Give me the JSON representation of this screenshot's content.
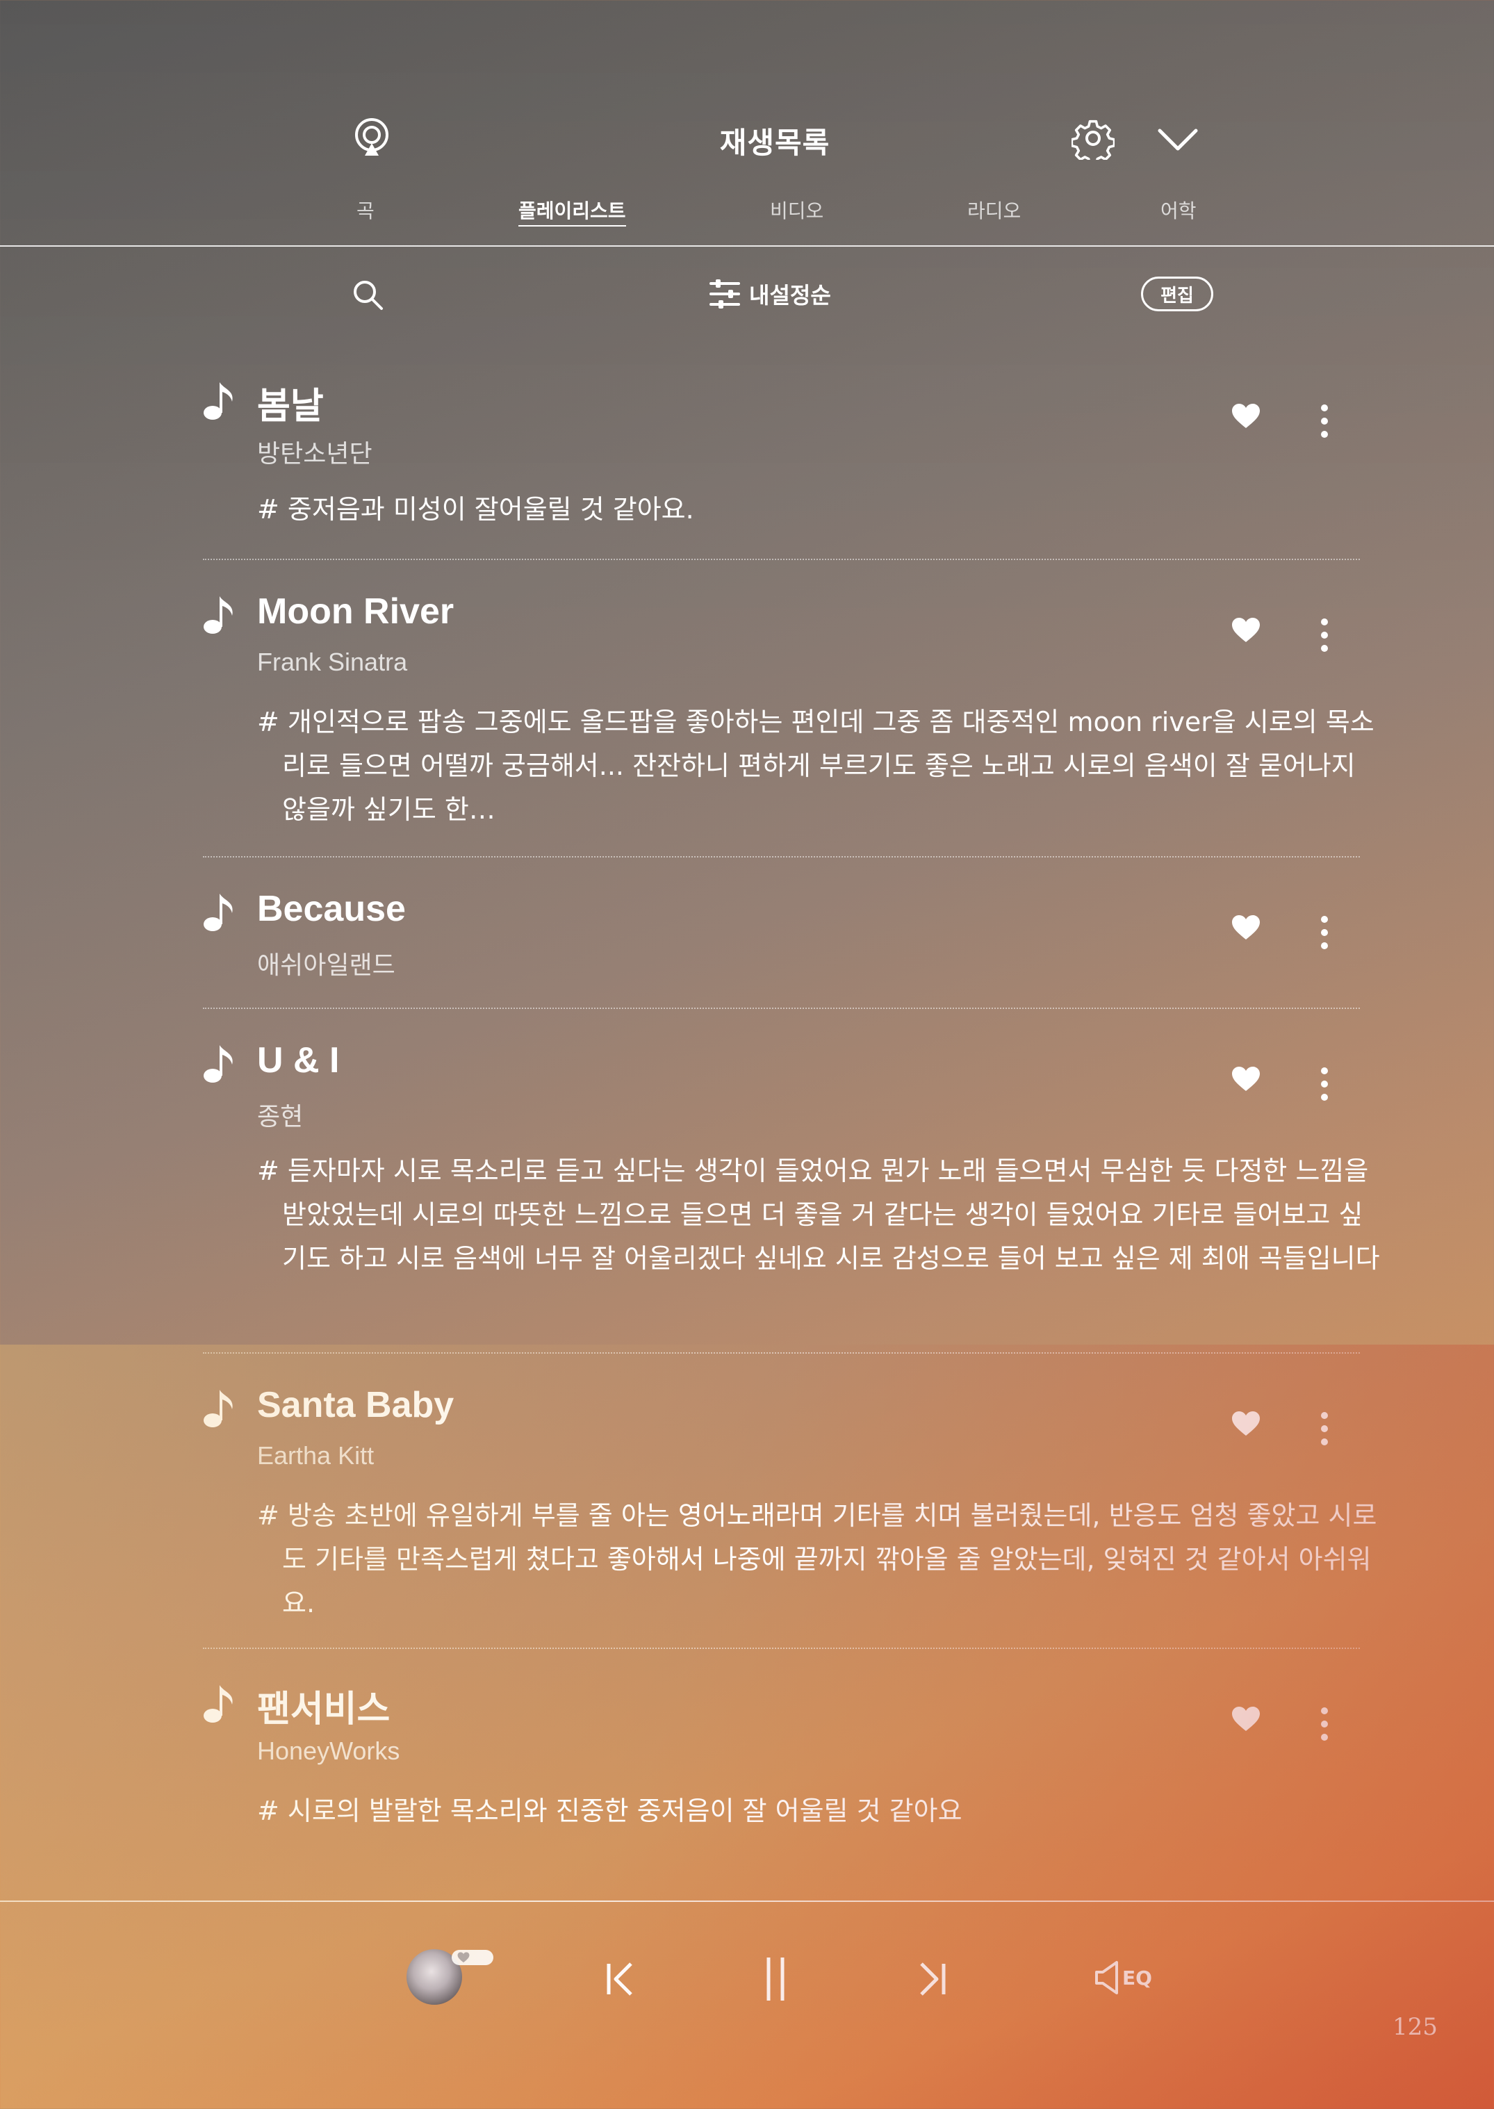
{
  "header": {
    "title": "재생목록",
    "tabs": [
      {
        "label": "곡",
        "active": false
      },
      {
        "label": "플레이리스트",
        "active": true
      },
      {
        "label": "비디오",
        "active": false
      },
      {
        "label": "라디오",
        "active": false
      },
      {
        "label": "어학",
        "active": false
      }
    ]
  },
  "toolbar": {
    "sort_label": "내설정순",
    "edit_label": "편집"
  },
  "playlist": [
    {
      "title": "봄날",
      "artist": "방탄소년단",
      "comment": "# 중저음과 미성이 잘어울릴 것 같아요."
    },
    {
      "title": "Moon River",
      "artist": "Frank Sinatra",
      "comment": "# 개인적으로 팝송 그중에도 올드팝을 좋아하는 편인데 그중 좀 대중적인 moon river을 시로의 목소리로 들으면 어떨까 궁금해서... 잔잔하니 편하게 부르기도 좋은 노래고 시로의 음색이 잘 묻어나지 않을까 싶기도 한…"
    },
    {
      "title": "Because",
      "artist": "애쉬아일랜드",
      "comment": ""
    },
    {
      "title": "U & I",
      "artist": "종현",
      "comment": "# 듣자마자 시로 목소리로 듣고 싶다는 생각이 들었어요 뭔가 노래 들으면서 무심한 듯 다정한 느낌을 받았었는데 시로의 따뜻한 느낌으로 들으면 더 좋을 거 같다는 생각이 들었어요 기타로 들어보고 싶기도 하고 시로 음색에 너무 잘 어울리겠다 싶네요 시로 감성으로 들어 보고 싶은 제 최애 곡들입니다"
    },
    {
      "title": "Santa Baby",
      "artist": "Eartha Kitt",
      "comment": "# 방송 초반에 유일하게 부를 줄 아는 영어노래라며 기타를 치며 불러줬는데, 반응도 엄청 좋았고 시로도 기타를 만족스럽게 쳤다고 좋아해서 나중에 끝까지 깎아올 줄 알았는데, 잊혀진 것 같아서 아쉬워요."
    },
    {
      "title": "팬서비스",
      "artist": "HoneyWorks",
      "comment": "# 시로의 발랄한 목소리와 진중한 중저음이 잘 어울릴 것 같아요"
    }
  ],
  "player": {
    "eq_label": "EQ"
  },
  "page_number": "125",
  "icons": {
    "cast": "cast-icon",
    "settings": "gear-icon",
    "collapse": "chevron-down-icon",
    "search": "search-icon",
    "sort": "sliders-icon",
    "note": "music-note-icon",
    "like": "heart-icon",
    "more": "more-vertical-icon",
    "prev": "skip-previous-icon",
    "pause": "pause-icon",
    "next": "skip-next-icon",
    "eq": "speaker-eq-icon"
  }
}
